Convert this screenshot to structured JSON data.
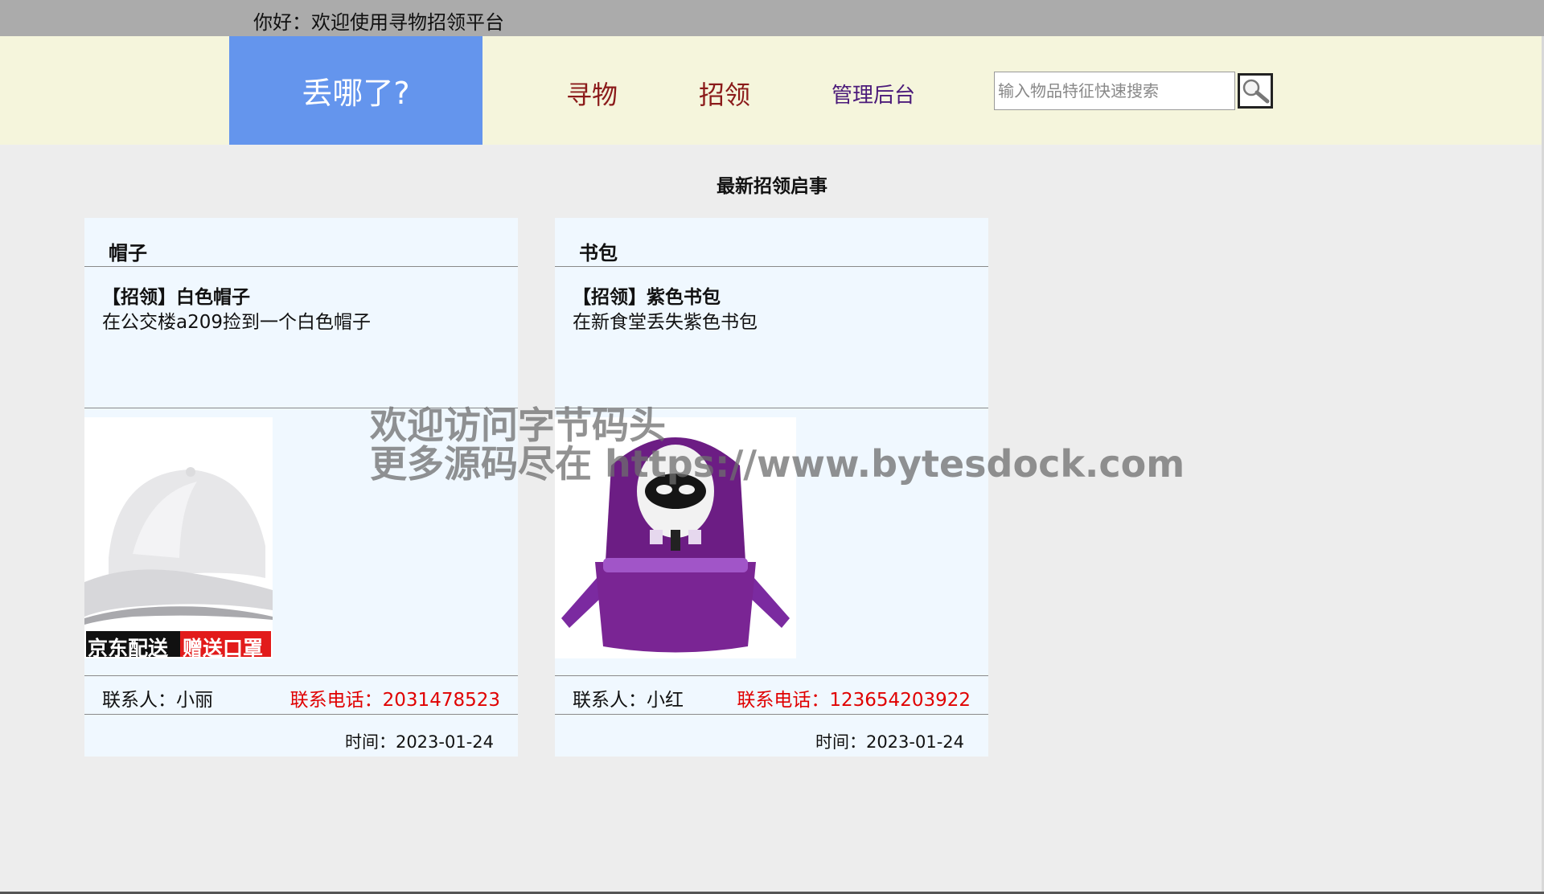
{
  "topbar": {
    "greeting": "你好：欢迎使用寻物招领平台"
  },
  "header": {
    "logo": "丢哪了?",
    "nav": [
      {
        "label": "寻物"
      },
      {
        "label": "招领"
      },
      {
        "label": "管理后台"
      }
    ],
    "search": {
      "placeholder": "输入物品特征快速搜索",
      "value": ""
    },
    "colors": {
      "logo_bg": "#6495ed",
      "header_bg": "#f5f5dc",
      "nav": "#8b1a1a",
      "admin": "#4b1a7a"
    }
  },
  "main": {
    "title": "最新招领启事",
    "cards": [
      {
        "category": "帽子",
        "headline": "【招领】白色帽子",
        "desc": "在公交楼a209捡到一个白色帽子",
        "image": "white-cap-image",
        "image_badge_left": "京东配送",
        "image_badge_right": "赠送口罩",
        "contact": "联系人：小丽",
        "phone": "联系电话：2031478523",
        "time": "时间：2023-01-24"
      },
      {
        "category": "书包",
        "headline": "【招领】紫色书包",
        "desc": "在新食堂丢失紫色书包",
        "image": "purple-backpack-image",
        "contact": "联系人：小红",
        "phone": "联系电话：123654203922",
        "time": "时间：2023-01-24"
      }
    ]
  },
  "watermark": {
    "line1": "欢迎访问字节码头",
    "line2": "更多源码尽在  https://www.bytesdock.com"
  }
}
